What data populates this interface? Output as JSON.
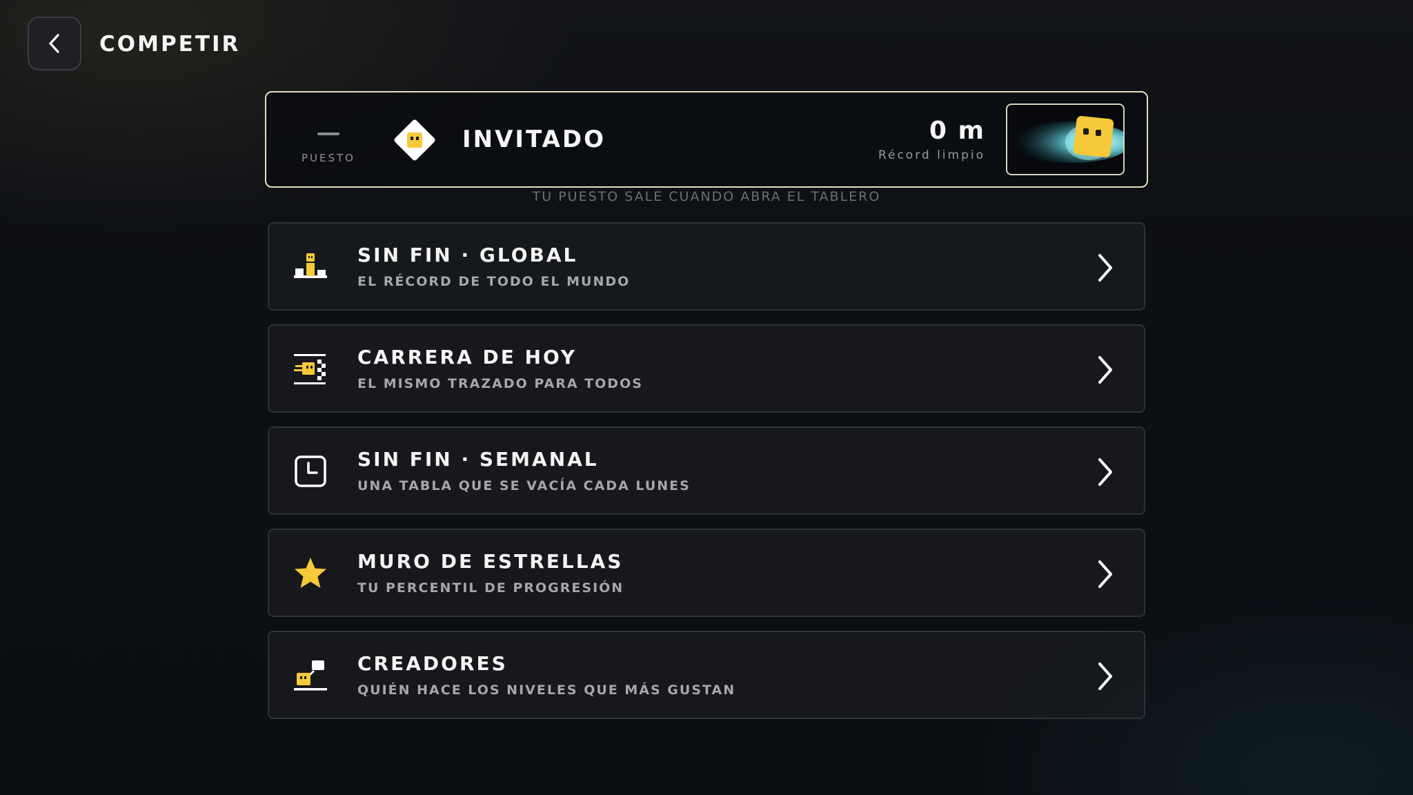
{
  "header": {
    "title": "COMPETIR",
    "back_icon": "chevron-left-icon"
  },
  "profile": {
    "rank_value": "—",
    "rank_label": "PUESTO",
    "name": "INVITADO",
    "record_value": "0 m",
    "record_label": "Récord limpio",
    "hint": "TU PUESTO SALE CUANDO ABRA EL TABLERO"
  },
  "modes": [
    {
      "title": "SIN FIN · GLOBAL",
      "subtitle": "EL RÉCORD DE TODO EL MUNDO",
      "icon": "podium-icon"
    },
    {
      "title": "CARRERA DE HOY",
      "subtitle": "EL MISMO TRAZADO PARA TODOS",
      "icon": "race-finish-icon"
    },
    {
      "title": "SIN FIN · SEMANAL",
      "subtitle": "UNA TABLA QUE SE VACÍA CADA LUNES",
      "icon": "clock-icon"
    },
    {
      "title": "MURO DE ESTRELLAS",
      "subtitle": "TU PERCENTIL DE PROGRESIÓN",
      "icon": "star-icon"
    },
    {
      "title": "CREADORES",
      "subtitle": "QUIÉN HACE LOS NIVELES QUE MÁS GUSTAN",
      "icon": "creator-icon"
    }
  ],
  "colors": {
    "accent_yellow": "#f5c93a",
    "card_border": "#e8dfbf",
    "row_border": "#2e3136",
    "glow_cyan": "#7fe8f0"
  }
}
